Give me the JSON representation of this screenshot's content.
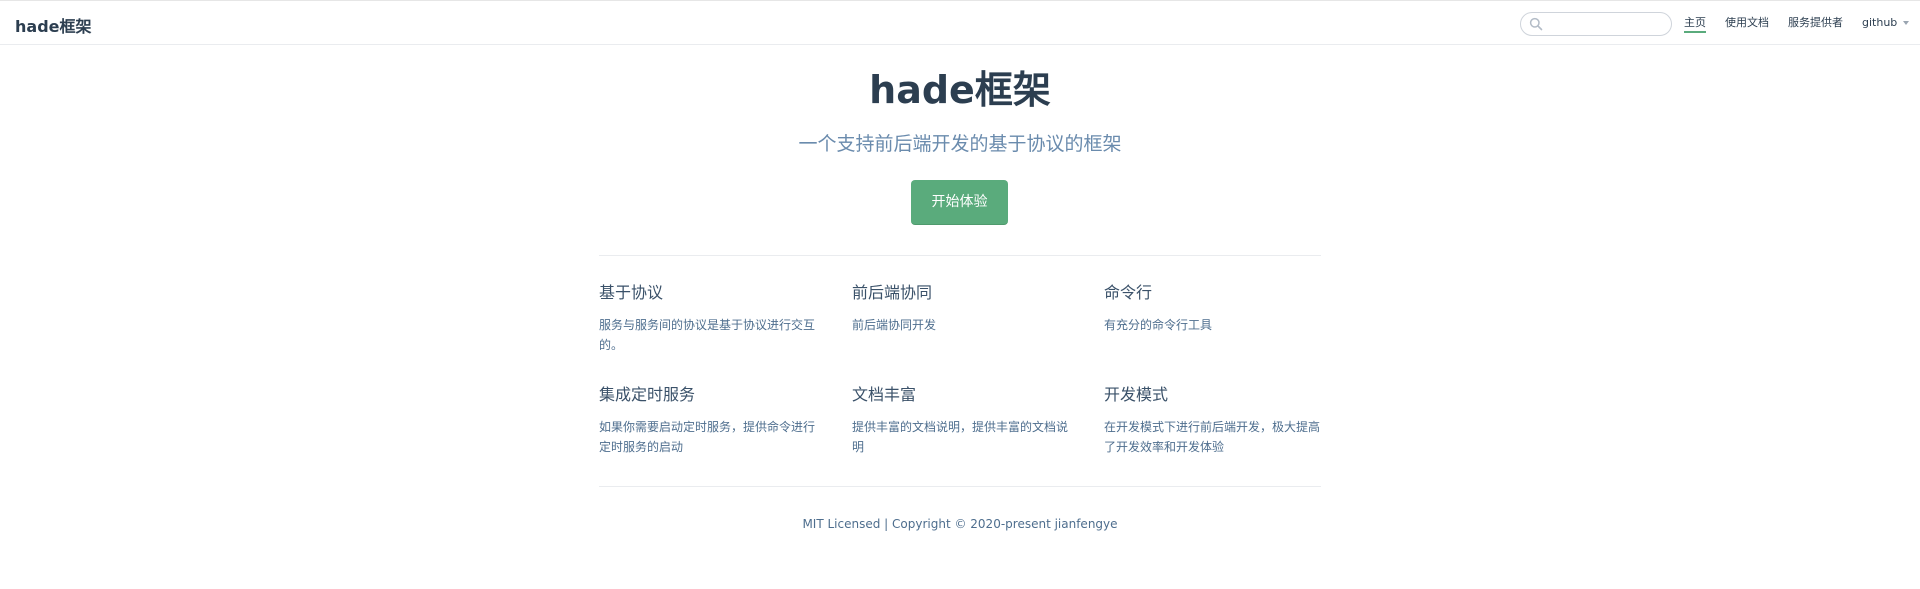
{
  "navbar": {
    "site_name": "hade框架",
    "search": {
      "value": "",
      "placeholder": ""
    },
    "items": [
      {
        "label": "主页",
        "active": true
      },
      {
        "label": "使用文档",
        "active": false
      },
      {
        "label": "服务提供者",
        "active": false
      },
      {
        "label": "github",
        "active": false,
        "dropdown": true
      }
    ]
  },
  "hero": {
    "title": "hade框架",
    "description": "一个支持前后端开发的基于协议的框架",
    "action_label": "开始体验"
  },
  "features": [
    {
      "title": "基于协议",
      "details": "服务与服务间的协议是基于协议进行交互的。"
    },
    {
      "title": "前后端协同",
      "details": "前后端协同开发"
    },
    {
      "title": "命令行",
      "details": "有充分的命令行工具"
    },
    {
      "title": "集成定时服务",
      "details": "如果你需要启动定时服务，提供命令进行定时服务的启动"
    },
    {
      "title": "文档丰富",
      "details": "提供丰富的文档说明，提供丰富的文档说明"
    },
    {
      "title": "开发模式",
      "details": "在开发模式下进行前后端开发，极大提高了开发效率和开发体验"
    }
  ],
  "footer": {
    "text": "MIT Licensed | Copyright © 2020-present jianfengye"
  },
  "colors": {
    "accent": "#5aab7c",
    "text": "#2c3e50",
    "muted": "#6a8bad"
  }
}
